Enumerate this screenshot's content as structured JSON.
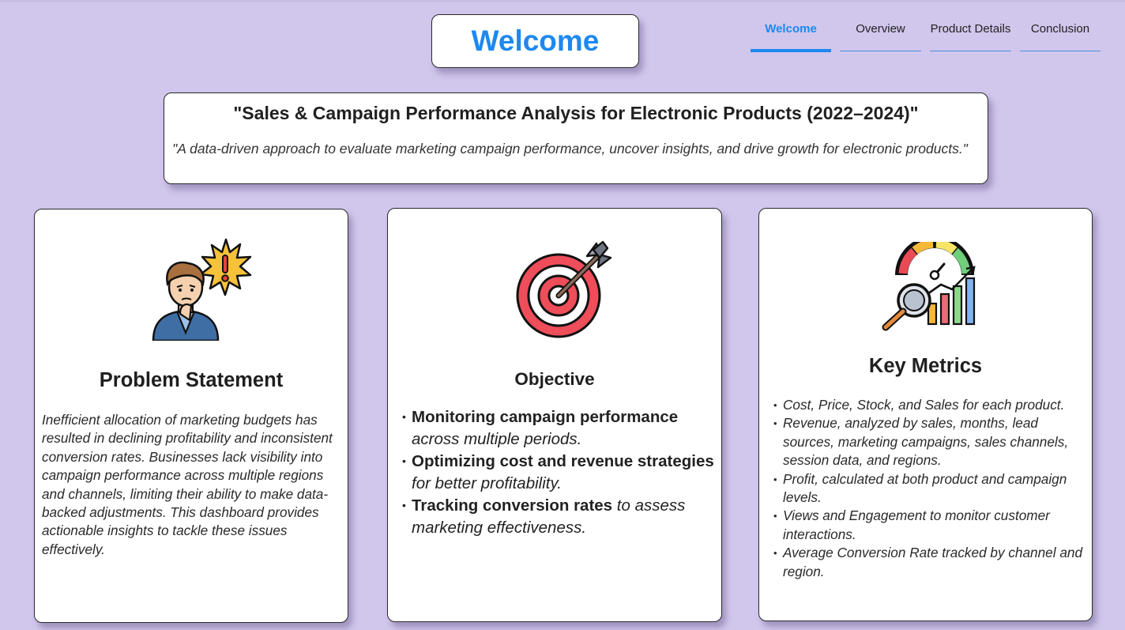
{
  "header": {
    "welcome": "Welcome"
  },
  "nav": {
    "tabs": [
      {
        "label": "Welcome",
        "active": true
      },
      {
        "label": "Overview",
        "active": false
      },
      {
        "label": "Product Details",
        "active": false
      },
      {
        "label": "Conclusion",
        "active": false
      }
    ]
  },
  "hero": {
    "title": "\"Sales & Campaign Performance Analysis for Electronic Products (2022–2024)\"",
    "subtitle": "\"A data-driven approach to evaluate marketing campaign performance, uncover insights, and drive growth for electronic  products.\""
  },
  "problem": {
    "icon": "worried-person-alert-icon",
    "title": "Problem Statement",
    "text": "Inefficient allocation of marketing budgets has resulted in declining profitability and inconsistent conversion rates. Businesses lack visibility into campaign performance across multiple regions and channels, limiting their ability to make data-backed adjustments. This dashboard provides actionable insights to tackle these issues effectively."
  },
  "objective": {
    "icon": "target-arrow-icon",
    "title": "Objective",
    "items": [
      {
        "bold": "Monitoring campaign performance",
        "rest": " across multiple periods."
      },
      {
        "bold": "Optimizing cost and revenue strategies",
        "rest": " for better profitability."
      },
      {
        "bold": "Tracking conversion rates",
        "rest": " to assess marketing effectiveness."
      }
    ]
  },
  "metrics": {
    "icon": "analytics-gauge-magnifier-icon",
    "title": "Key Metrics",
    "items": [
      " Cost, Price, Stock, and Sales for each product.",
      " Revenue, analyzed by sales, months, lead sources, marketing campaigns, sales channels, session data, and regions.",
      "Profit, calculated at both product and campaign levels.",
      " Views and Engagement to monitor customer interactions.",
      " Average Conversion Rate tracked by channel and region."
    ]
  },
  "colors": {
    "background": "#d1c6ec",
    "accent": "#1e88f0",
    "card": "#ffffff"
  }
}
